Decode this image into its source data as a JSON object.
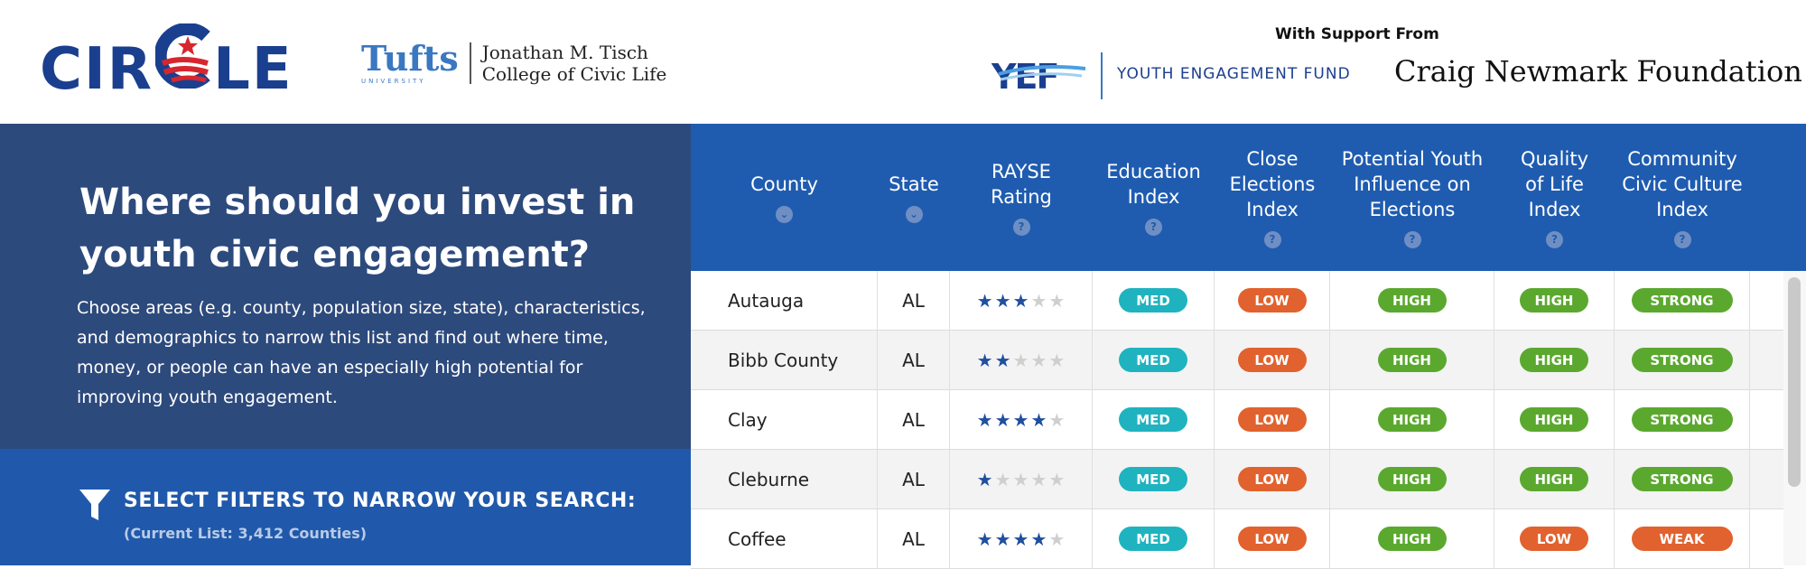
{
  "header": {
    "brand": "CIRCLE",
    "tufts_name": "Tufts",
    "tufts_sub": "UNIVERSITY",
    "tufts_college_line1": "Jonathan M. Tisch",
    "tufts_college_line2": "College of Civic Life",
    "support_label": "With Support From",
    "yef_text": "YOUTH ENGAGEMENT FUND",
    "craig_text": "Craig Newmark Foundation"
  },
  "intro": {
    "headline": "Where should you invest in youth civic engagement?",
    "description": "Choose areas (e.g. county, population size, state), characteristics, and demographics to narrow this list and find out where time, money, or people can have an especially high potential for improving youth engagement."
  },
  "filters": {
    "title": "SELECT FILTERS TO NARROW YOUR SEARCH:",
    "current_list": "(Current List: 3,412 Counties)",
    "icon": "funnel-icon"
  },
  "table": {
    "columns": [
      {
        "label": "County",
        "icon": "chevron-down-icon"
      },
      {
        "label": "State",
        "icon": "chevron-down-icon"
      },
      {
        "label": "RAYSE\nRating",
        "icon": "help-icon"
      },
      {
        "label": "Education\nIndex",
        "icon": "help-icon"
      },
      {
        "label": "Close\nElections\nIndex",
        "icon": "help-icon"
      },
      {
        "label": "Potential Youth\nInfluence on\nElections",
        "icon": "help-icon"
      },
      {
        "label": "Quality\nof Life\nIndex",
        "icon": "help-icon"
      },
      {
        "label": "Community\nCivic Culture\nIndex",
        "icon": "help-icon"
      }
    ],
    "rows": [
      {
        "county": "Autauga",
        "state": "AL",
        "rating": 3,
        "education": "MED",
        "close_elections": "LOW",
        "influence": "HIGH",
        "quality": "HIGH",
        "civic_culture": "STRONG"
      },
      {
        "county": "Bibb County",
        "state": "AL",
        "rating": 2,
        "education": "MED",
        "close_elections": "LOW",
        "influence": "HIGH",
        "quality": "HIGH",
        "civic_culture": "STRONG"
      },
      {
        "county": "Clay",
        "state": "AL",
        "rating": 4,
        "education": "MED",
        "close_elections": "LOW",
        "influence": "HIGH",
        "quality": "HIGH",
        "civic_culture": "STRONG"
      },
      {
        "county": "Cleburne",
        "state": "AL",
        "rating": 1,
        "education": "MED",
        "close_elections": "LOW",
        "influence": "HIGH",
        "quality": "HIGH",
        "civic_culture": "STRONG"
      },
      {
        "county": "Coffee",
        "state": "AL",
        "rating": 4,
        "education": "MED",
        "close_elections": "LOW",
        "influence": "HIGH",
        "quality": "LOW",
        "civic_culture": "WEAK"
      }
    ],
    "rating_max": 5
  },
  "colors": {
    "MED": "#1fb3c0",
    "LOW": "#e1622e",
    "HIGH": "#5ba82f",
    "STRONG": "#5ba82f",
    "WEAK": "#e1622e",
    "panel_dark": "#2d4a7d",
    "panel_blue": "#2059ab",
    "table_header": "#1f5cb0"
  }
}
